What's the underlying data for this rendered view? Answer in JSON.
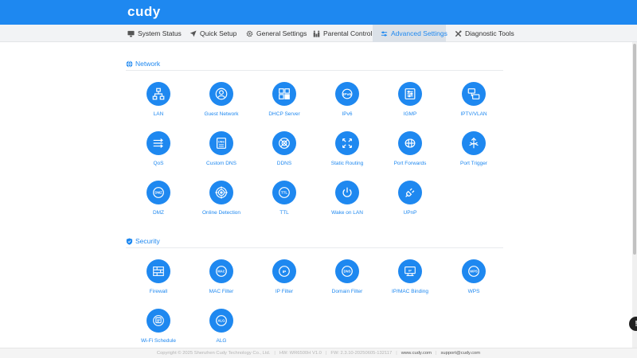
{
  "brand": {
    "logo_text": "cudy",
    "color": "#1e88f0"
  },
  "nav": {
    "tabs": [
      {
        "label": "System Status",
        "icon": "monitor-icon",
        "active": false
      },
      {
        "label": "Quick Setup",
        "icon": "wand-icon",
        "active": false
      },
      {
        "label": "General Settings",
        "icon": "gear-icon",
        "active": false
      },
      {
        "label": "Parental Control",
        "icon": "family-icon",
        "active": false
      },
      {
        "label": "Advanced Settings",
        "icon": "sliders-icon",
        "active": true
      },
      {
        "label": "Diagnostic Tools",
        "icon": "tools-icon",
        "active": false
      }
    ]
  },
  "sections": [
    {
      "title": "Network",
      "icon": "globe-icon",
      "items": [
        {
          "label": "LAN",
          "icon": "lan-icon"
        },
        {
          "label": "Guest Network",
          "icon": "guest-icon"
        },
        {
          "label": "DHCP Server",
          "icon": "dhcp-icon"
        },
        {
          "label": "IPv6",
          "icon": "ipv6-icon"
        },
        {
          "label": "IGMP",
          "icon": "igmp-icon"
        },
        {
          "label": "IPTV/VLAN",
          "icon": "iptv-icon"
        },
        {
          "label": "QoS",
          "icon": "qos-icon"
        },
        {
          "label": "Custom DNS",
          "icon": "custom-dns-icon"
        },
        {
          "label": "DDNS",
          "icon": "ddns-icon"
        },
        {
          "label": "Static Routing",
          "icon": "routing-icon"
        },
        {
          "label": "Port Forwards",
          "icon": "port-forward-icon"
        },
        {
          "label": "Port Trigger",
          "icon": "port-trigger-icon"
        },
        {
          "label": "DMZ",
          "icon": "dmz-icon"
        },
        {
          "label": "Online Detection",
          "icon": "detection-icon"
        },
        {
          "label": "TTL",
          "icon": "ttl-icon"
        },
        {
          "label": "Wake on LAN",
          "icon": "power-icon"
        },
        {
          "label": "UPnP",
          "icon": "plug-icon"
        }
      ]
    },
    {
      "title": "Security",
      "icon": "shield-icon",
      "items": [
        {
          "label": "Firewall",
          "icon": "firewall-icon"
        },
        {
          "label": "MAC Filter",
          "icon": "mac-icon"
        },
        {
          "label": "IP Filter",
          "icon": "ip-icon"
        },
        {
          "label": "Domain Filter",
          "icon": "dns-icon"
        },
        {
          "label": "IP/MAC Binding",
          "icon": "binding-icon"
        },
        {
          "label": "WPS",
          "icon": "wps-icon"
        },
        {
          "label": "Wi-Fi Schedule",
          "icon": "schedule-icon"
        },
        {
          "label": "ALG",
          "icon": "alg-icon"
        }
      ]
    }
  ],
  "footer": {
    "copyright": "Copyright © 2025 Shenzhen Cudy Technology Co., Ltd.",
    "hw": "HW: WR6500H V1.0",
    "fw": "FW: 2.3.10-20250605-132117",
    "website": "www.cudy.com",
    "email": "support@cudy.com"
  }
}
